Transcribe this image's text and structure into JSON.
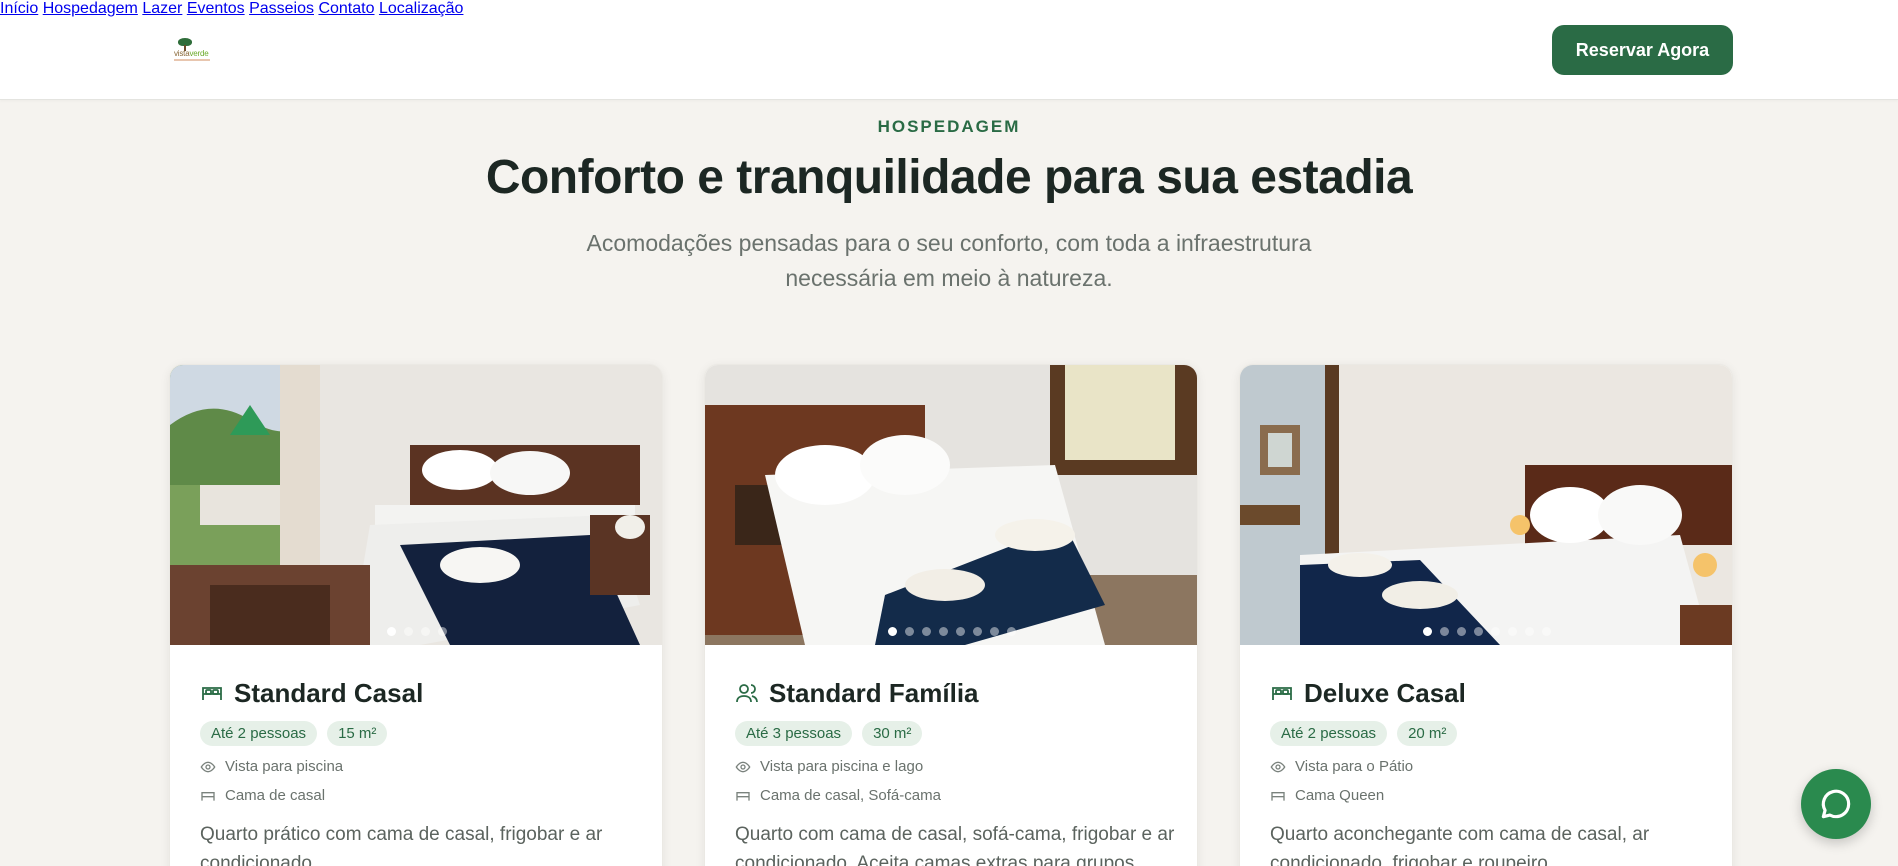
{
  "header": {
    "logo_text_a": "vista",
    "logo_text_b": "verde",
    "nav": [
      "Início",
      "Hospedagem",
      "Lazer",
      "Eventos",
      "Passeios",
      "Contato",
      "Localização"
    ],
    "cta_label": "Reservar Agora"
  },
  "section": {
    "eyebrow": "HOSPEDAGEM",
    "title": "Conforto e tranquilidade para sua estadia",
    "subtitle": "Acomodações pensadas para o seu conforto, com toda a infraestrutura necessária em meio à natureza."
  },
  "rooms": [
    {
      "icon": "bed-icon",
      "name": "Standard Casal",
      "guests": "Até 2 pessoas",
      "area": "15 m²",
      "view": "Vista para piscina",
      "bed": "Cama de casal",
      "description": "Quarto prático com cama de casal, frigobar e ar condicionado.",
      "photo_count": 4,
      "active_photo": 1
    },
    {
      "icon": "users-icon",
      "name": "Standard Família",
      "guests": "Até 3 pessoas",
      "area": "30 m²",
      "view": "Vista para piscina e lago",
      "bed": "Cama de casal, Sofá-cama",
      "description": "Quarto com cama de casal, sofá-cama, frigobar e ar condicionado. Aceita camas extras para grupos.",
      "photo_count": 8,
      "active_photo": 1
    },
    {
      "icon": "bed-icon",
      "name": "Deluxe Casal",
      "guests": "Até 2 pessoas",
      "area": "20 m²",
      "view": "Vista para o Pátio",
      "bed": "Cama Queen",
      "description": "Quarto aconchegante com cama de casal, ar condicionado, frigobar e roupeiro.",
      "photo_count": 8,
      "active_photo": 1
    }
  ],
  "colors": {
    "brand_green": "#2a6b45",
    "chip_bg": "#e6f0e8",
    "whatsapp": "#2a8a4e",
    "page_bg": "#f5f3ef"
  }
}
